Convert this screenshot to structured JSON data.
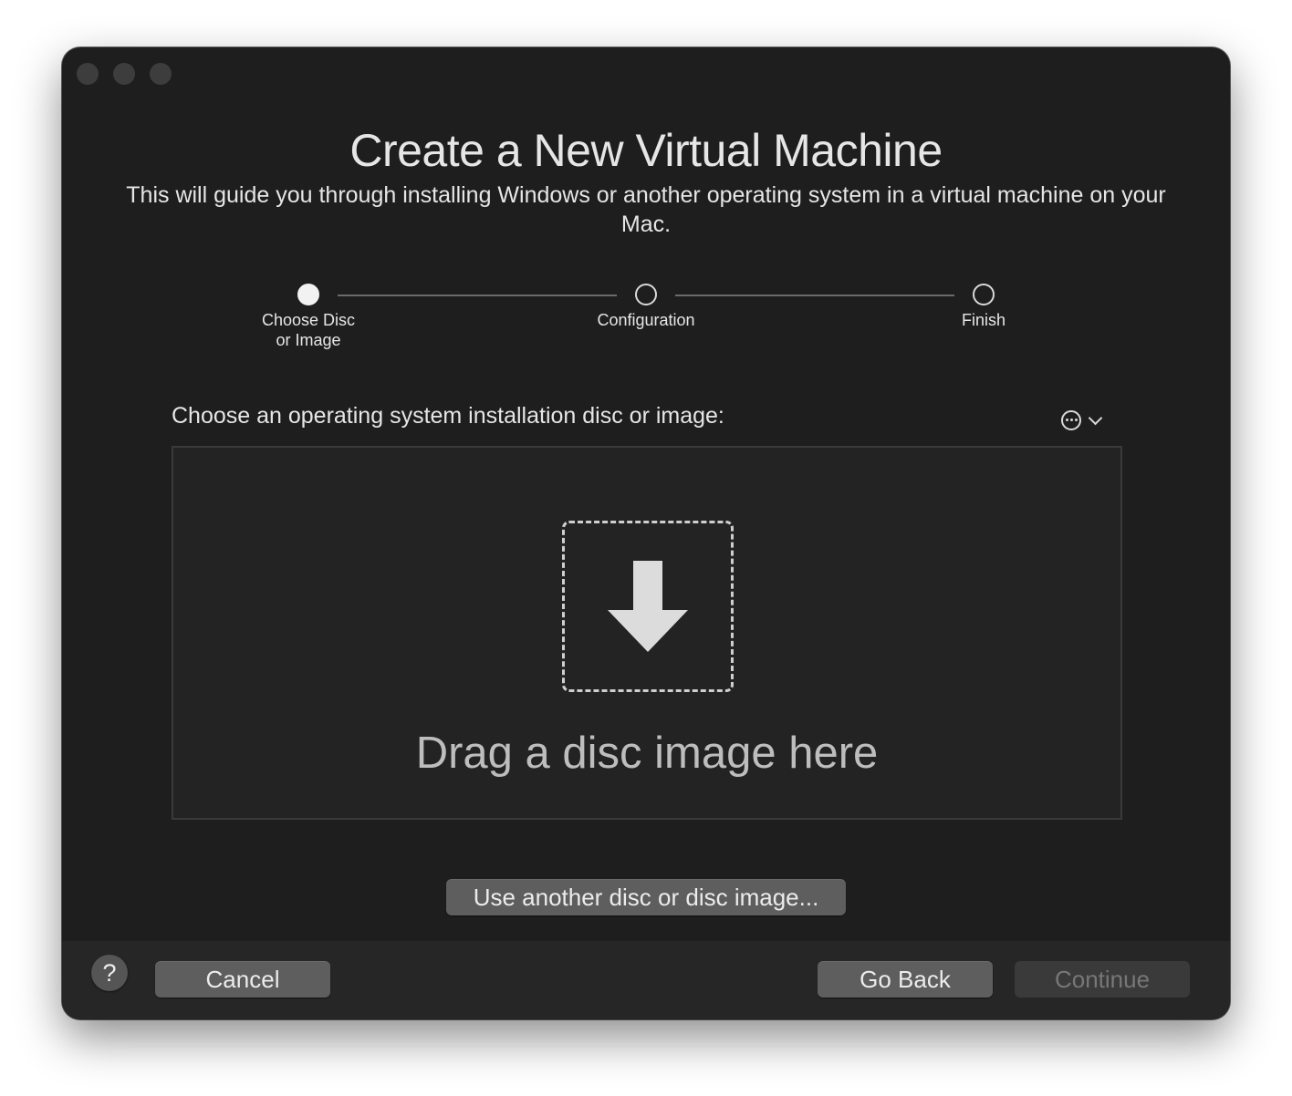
{
  "window": {
    "title": "Create a New Virtual Machine",
    "subtitle": "This will guide you through installing Windows or another operating system in a virtual machine on your Mac."
  },
  "steps": [
    {
      "label": "Choose Disc\nor Image",
      "state": "active"
    },
    {
      "label": "Configuration",
      "state": "inactive"
    },
    {
      "label": "Finish",
      "state": "inactive"
    }
  ],
  "main": {
    "prompt": "Choose an operating system installation disc or image:",
    "more_menu_icon": "ellipsis-circle-icon",
    "dropzone_text": "Drag a disc image here",
    "dropzone_icon": "down-arrow-icon",
    "other_button": "Use another disc or disc image..."
  },
  "footer": {
    "help_label": "?",
    "cancel_label": "Cancel",
    "back_label": "Go Back",
    "continue_label": "Continue",
    "continue_enabled": false
  },
  "colors": {
    "window_bg": "#1e1e1e",
    "button_bg": "#5e5e5e",
    "text": "#e6e6e6"
  }
}
